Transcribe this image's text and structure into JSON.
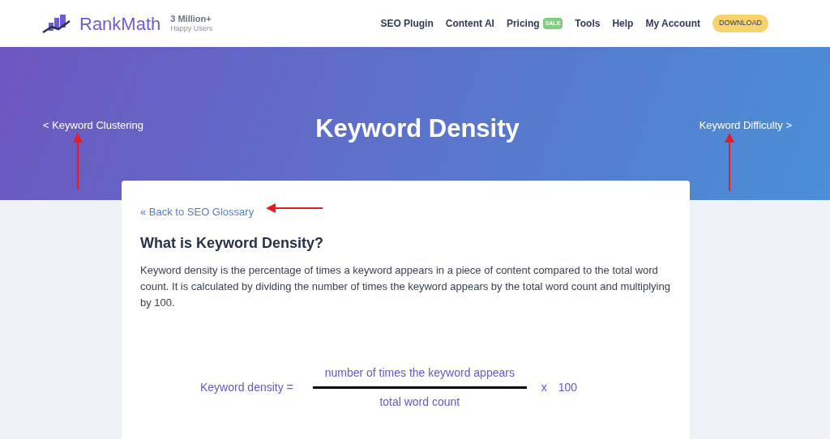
{
  "header": {
    "logo": "RankMath",
    "tagline_top": "3 Million+",
    "tagline_bottom": "Happy Users",
    "nav": [
      {
        "label": "SEO Plugin"
      },
      {
        "label": "Content AI"
      },
      {
        "label": "Pricing",
        "badge": "SALE"
      },
      {
        "label": "Tools"
      },
      {
        "label": "Help"
      },
      {
        "label": "My Account"
      }
    ],
    "download": "DOWNLOAD"
  },
  "hero": {
    "prev": "< Keyword Clustering",
    "title": "Keyword Density",
    "next": "Keyword Difficulty >"
  },
  "article": {
    "back": "« Back to SEO Glossary",
    "heading": "What is Keyword Density?",
    "paragraph": "Keyword density is the percentage of times a keyword appears in a piece of content compared to the total word count. It is calculated by dividing the number of times the keyword appears by the total word count and multiplying by 100.",
    "formula": {
      "label": "Keyword density =",
      "numerator": "number of times the keyword appears",
      "denominator": "total word count",
      "operator": "x",
      "factor": "100"
    }
  }
}
